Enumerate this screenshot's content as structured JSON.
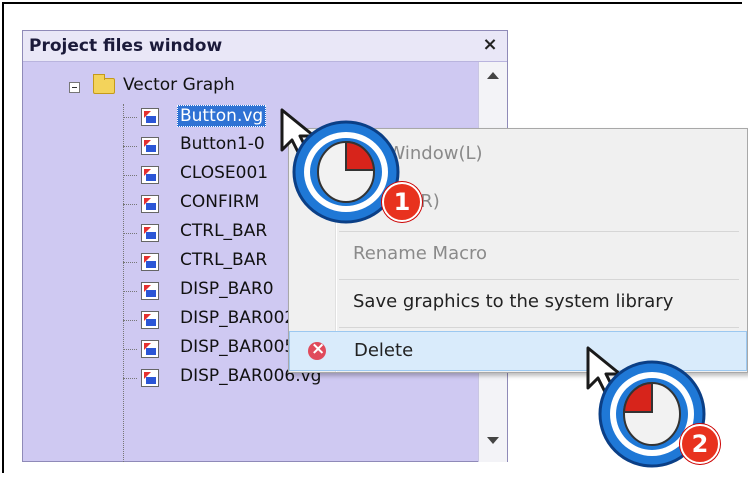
{
  "panel": {
    "title": "Project files window",
    "close_label": "×",
    "root_label": "Vector Graph",
    "items": [
      "Button.vg",
      "Button1-0",
      "CLOSE001",
      "CONFIRM",
      "CTRL_BAR",
      "CTRL_BAR",
      "DISP_BAR0",
      "DISP_BAR002.vg",
      "DISP_BAR005.vg",
      "DISP_BAR006.vg"
    ]
  },
  "menu": {
    "items": [
      {
        "label": "Init Window(L)",
        "disabled": true
      },
      {
        "label": "Recipe(R)",
        "disabled": true
      },
      {
        "label": "Rename Macro",
        "disabled": true
      },
      {
        "label": "Save graphics to the system library",
        "disabled": false
      },
      {
        "label": "Delete",
        "disabled": false,
        "icon": "delete-icon",
        "hovered": true
      }
    ]
  },
  "annotations": {
    "step1": "1",
    "step2": "2"
  },
  "colors": {
    "panel_bg": "#cfc9f2",
    "selection": "#2f72d4",
    "menu_hover": "#d9ebfb",
    "badge": "#e8321e",
    "mouse_ring": "#1f78d6"
  }
}
